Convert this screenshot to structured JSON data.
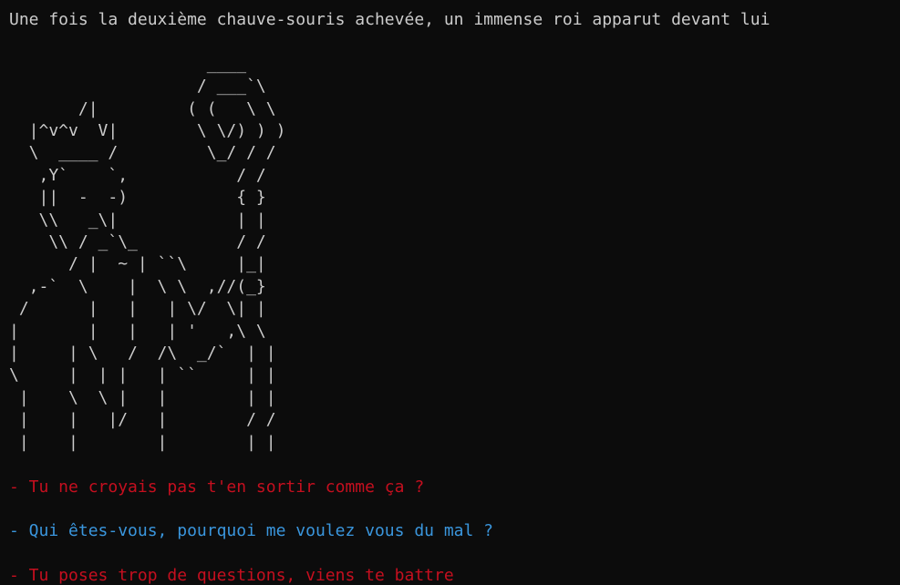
{
  "intro": "Une fois la deuxième chauve-souris achevée, un immense roi apparut devant lui",
  "ascii_art": [
    "",
    "                    ____",
    "                   / ___`\\",
    "       /|         ( (   \\ \\",
    "  |^v^v  V|        \\ \\/) ) )",
    "  \\  ____ /         \\_/ / /",
    "   ,Y`    `,           / /",
    "   ||  -  -)           { }",
    "   \\\\   _\\|            | |",
    "    \\\\ / _`\\_          / /",
    "      / |  ~ | ``\\     |_|",
    "  ,-`  \\    |  \\ \\  ,//(_}",
    " /      |   |   | \\/  \\| |",
    "|       |   |   | '   ,\\ \\",
    "|     | \\   /  /\\  _/`  | |",
    "\\     |  | |   | ``     | |",
    " |    \\  \\ |   |        | |",
    " |    |   |/   |        / /",
    " |    |        |        | |"
  ],
  "dialogue": [
    {
      "speaker": "king",
      "color": "#c50f1f",
      "text": "- Tu ne croyais pas t'en sortir comme ça ?"
    },
    {
      "speaker": "hero",
      "color": "#3a96dd",
      "text": "- Qui êtes-vous, pourquoi me voulez vous du mal ?"
    },
    {
      "speaker": "king",
      "color": "#c50f1f",
      "text": "- Tu poses trop de questions, viens te battre"
    }
  ]
}
